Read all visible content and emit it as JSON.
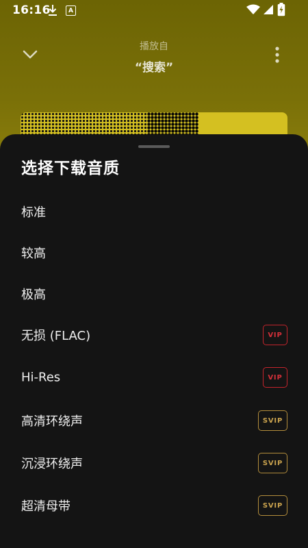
{
  "status_bar": {
    "time": "16:16",
    "app_icon_letter": "A"
  },
  "header": {
    "subtitle": "播放自",
    "title": "“搜索”"
  },
  "sheet": {
    "title": "选择下载音质",
    "options": [
      {
        "label": "标准",
        "badge": ""
      },
      {
        "label": "较高",
        "badge": ""
      },
      {
        "label": "极高",
        "badge": ""
      },
      {
        "label": "无损 (FLAC)",
        "badge": "VIP"
      },
      {
        "label": "Hi-Res",
        "badge": "VIP"
      },
      {
        "label": "高清环绕声",
        "badge": "SVIP"
      },
      {
        "label": "沉浸环绕声",
        "badge": "SVIP"
      },
      {
        "label": "超清母带",
        "badge": "SVIP"
      }
    ]
  },
  "colors": {
    "vip_red": "#d5303a",
    "svip_gold": "#caa34e",
    "sheet_bg": "#141414",
    "header_bg": "#7a7008"
  }
}
